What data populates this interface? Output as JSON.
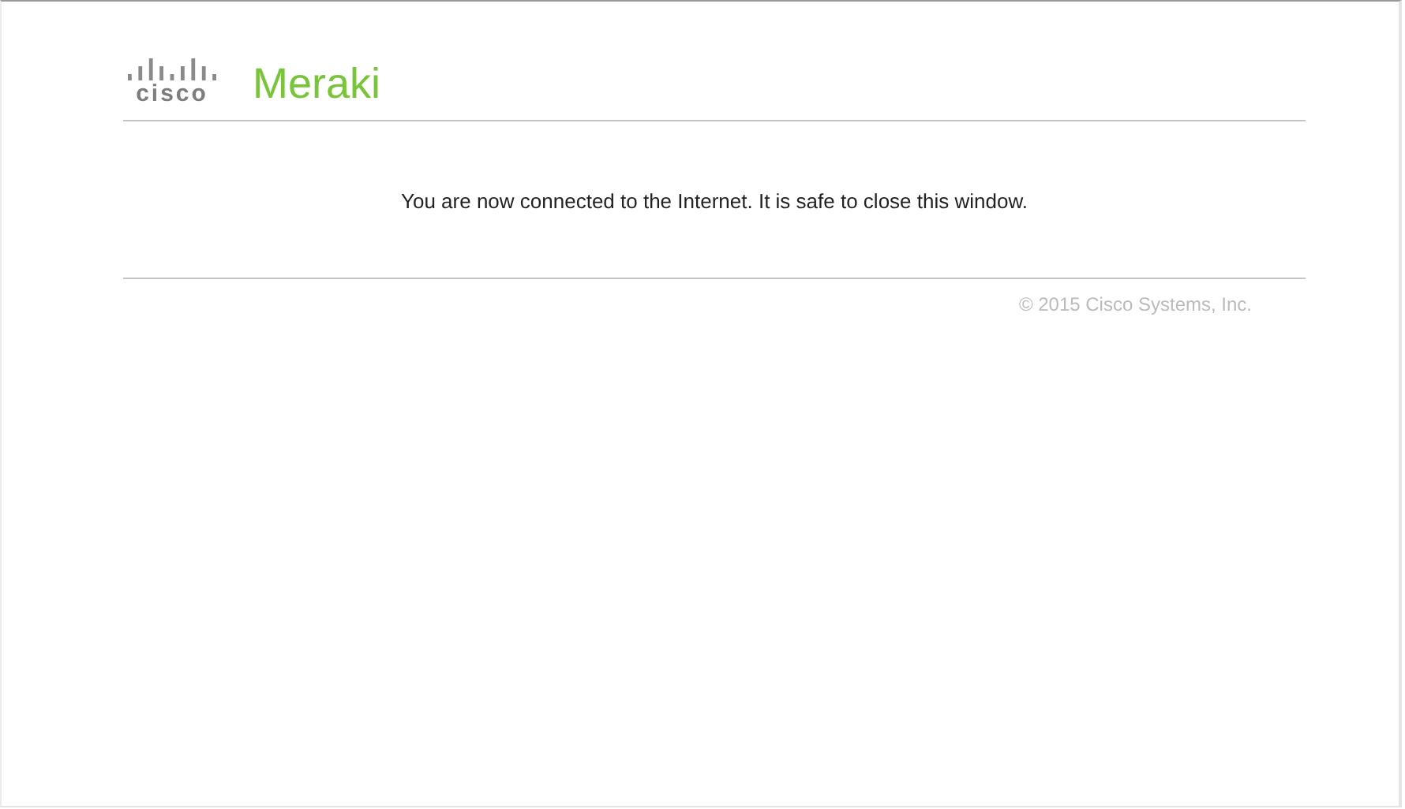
{
  "header": {
    "logo_text": "cisco",
    "product": "Meraki"
  },
  "message": "You are now connected to the Internet. It is safe to close this window.",
  "footer": {
    "copyright": "© 2015 Cisco Systems, Inc."
  }
}
